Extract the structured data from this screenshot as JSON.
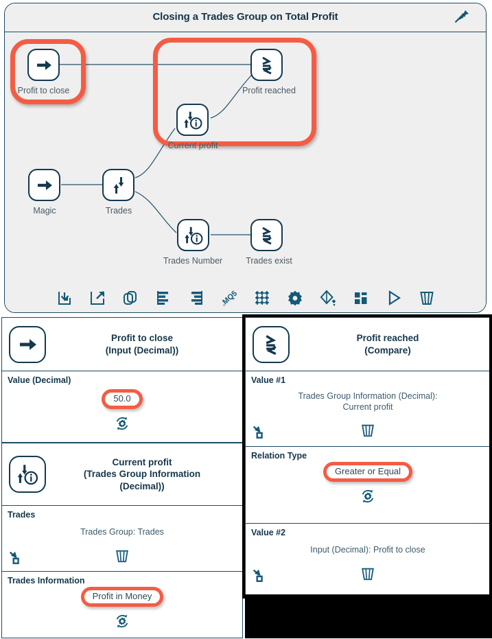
{
  "window": {
    "title": "Closing a Trades Group on Total Profit",
    "pin_icon": "pushpin-icon"
  },
  "diagram": {
    "nodes": [
      {
        "id": "profit-to-close",
        "label": "Profit to close",
        "icon": "arrow-right-icon",
        "highlighted": true
      },
      {
        "id": "profit-reached",
        "label": "Profit reached",
        "icon": "compare-icon",
        "highlighted": false
      },
      {
        "id": "current-profit",
        "label": "Current profit",
        "icon": "trades-info-icon",
        "highlighted": false
      },
      {
        "id": "magic",
        "label": "Magic",
        "icon": "arrow-right-icon",
        "highlighted": false
      },
      {
        "id": "trades",
        "label": "Trades",
        "icon": "trades-icon",
        "highlighted": false
      },
      {
        "id": "trades-number",
        "label": "Trades Number",
        "icon": "trades-info-icon",
        "highlighted": false
      },
      {
        "id": "trades-exist",
        "label": "Trades exist",
        "icon": "compare-icon",
        "highlighted": false
      }
    ],
    "toolbar": [
      {
        "name": "import-icon",
        "title": "Import"
      },
      {
        "name": "export-icon",
        "title": "Export"
      },
      {
        "name": "copy-icon",
        "title": "Copy"
      },
      {
        "name": "align-left-icon",
        "title": "Align left"
      },
      {
        "name": "align-right-icon",
        "title": "Align right"
      },
      {
        "name": "mq5-icon",
        "title": ".MQ5",
        "label": ".MQ5"
      },
      {
        "name": "grid-icon",
        "title": "Grid"
      },
      {
        "name": "gear-icon",
        "title": "Settings"
      },
      {
        "name": "fill-color-icon",
        "title": "Fill color"
      },
      {
        "name": "blocks-icon",
        "title": "Blocks"
      },
      {
        "name": "play-icon",
        "title": "Run"
      },
      {
        "name": "trash-icon",
        "title": "Delete"
      }
    ]
  },
  "left_panel": {
    "cards": [
      {
        "icon": "arrow-right-icon",
        "title_line1": "Profit to close",
        "title_line2": "(Input (Decimal))",
        "fields": [
          {
            "label": "Value (Decimal)",
            "value": "50.0",
            "value_highlighted": true,
            "action_icon": "gear-refresh-icon"
          }
        ]
      },
      {
        "icon": "trades-info-icon",
        "title_line1": "Current profit",
        "title_line2": "(Trades Group Information",
        "title_line3": "(Decimal))",
        "fields": [
          {
            "label": "Trades",
            "value": "Trades Group: Trades",
            "value_highlighted": false,
            "link_icon": "link-node-icon",
            "action_icon": "trash-icon"
          },
          {
            "label": "Trades Information",
            "value": "Profit in Money",
            "value_highlighted": true,
            "action_icon": "gear-refresh-icon"
          }
        ]
      }
    ]
  },
  "right_panel": {
    "cards": [
      {
        "icon": "compare-icon",
        "title_line1": "Profit reached",
        "title_line2": "(Compare)",
        "fields": [
          {
            "label": "Value #1",
            "value": "Trades Group Information (Decimal):",
            "value2": "Current profit",
            "value_highlighted": false,
            "link_icon": "link-node-icon",
            "action_icon": "trash-icon"
          },
          {
            "label": "Relation Type",
            "value": "Greater or Equal",
            "value_highlighted": true,
            "action_icon": "gear-refresh-icon"
          },
          {
            "label": "Value #2",
            "value": "Input (Decimal): Profit to close",
            "value_highlighted": false,
            "link_icon": "link-node-icon",
            "action_icon": "trash-icon"
          }
        ]
      }
    ]
  },
  "colors": {
    "accent_dark": "#14394f",
    "highlight_red": "#f45c44",
    "panel_bg": "#efefef",
    "text_muted": "#4a5a63"
  }
}
